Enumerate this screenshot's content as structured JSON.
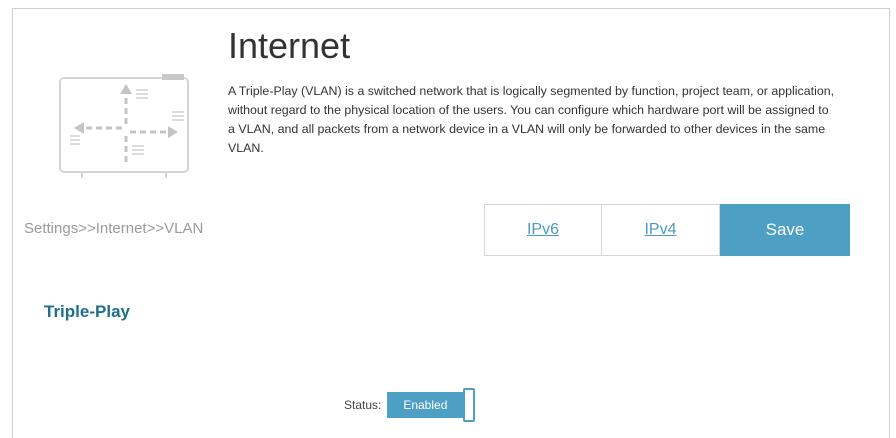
{
  "header": {
    "title": "Internet",
    "description": "A Triple-Play (VLAN) is a switched network that is logically segmented by function, project team, or application, without regard to the physical location of the users. You can configure which hardware port will be assigned to a VLAN, and all packets from a network device in a VLAN will only be forwarded to other devices in the same VLAN."
  },
  "breadcrumb": "Settings>>Internet>>VLAN",
  "toolbar": {
    "ipv6_label": "IPv6",
    "ipv4_label": "IPv4",
    "save_label": "Save"
  },
  "section": {
    "title": "Triple-Play",
    "status_label": "Status:",
    "status_value": "Enabled"
  },
  "colors": {
    "accent": "#4d9fc4",
    "section_title": "#1f6f8b",
    "link": "#4a9bbd",
    "muted_text": "#9a9a9a"
  },
  "icons": {
    "header_illustration": "router-network-illustration"
  }
}
